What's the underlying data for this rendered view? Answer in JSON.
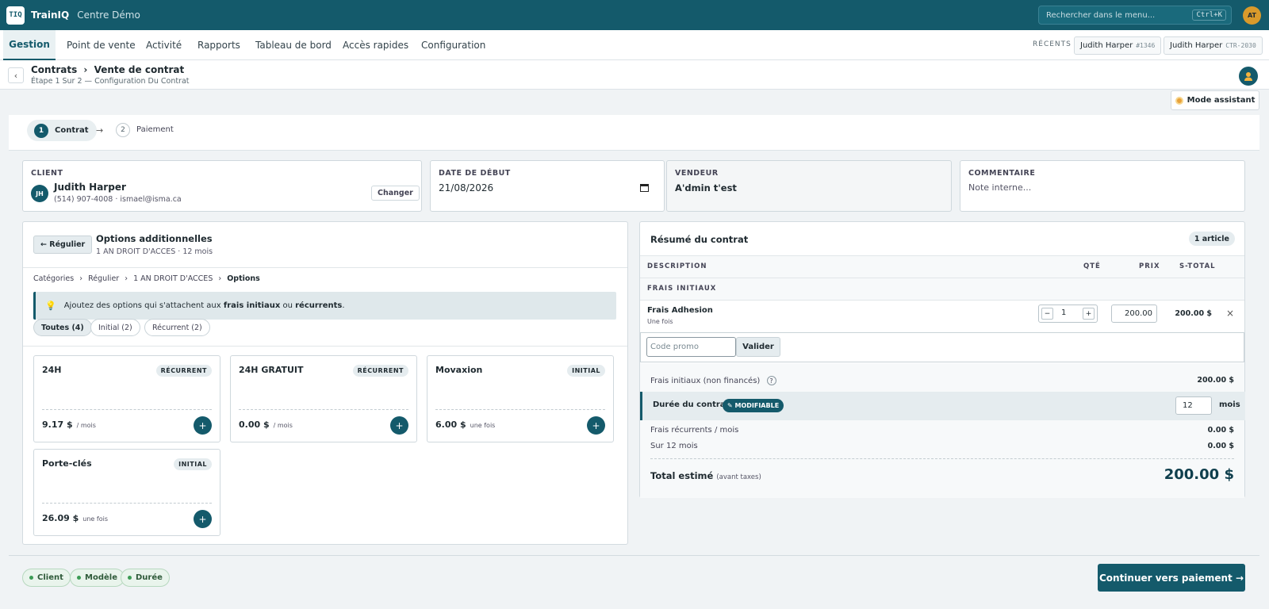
{
  "app": {
    "logo": "TIQ",
    "name": "TrainIQ",
    "centre": "Centre Démo",
    "search_placeholder": "Rechercher dans le menu...",
    "search_shortcut": "Ctrl+K",
    "user_initials": "AT"
  },
  "nav": {
    "tabs": [
      "Gestion",
      "Point de vente",
      "Activité",
      "Rapports",
      "Tableau de bord",
      "Accès rapides",
      "Configuration"
    ],
    "recent_label": "RÉCENTS",
    "recent": [
      {
        "name": "Judith Harper",
        "code": "#1346"
      },
      {
        "name": "Judith Harper",
        "code": "CTR-2030"
      }
    ]
  },
  "breadcrumb": {
    "parent": "Contrats",
    "sep": "›",
    "current": "Vente de contrat",
    "subtitle": "Étape 1 Sur 2 — Configuration Du Contrat",
    "back": "‹"
  },
  "assistant": {
    "label": "Mode assistant"
  },
  "steps": [
    {
      "num": "1",
      "label": "Contrat"
    },
    {
      "num": "2",
      "label": "Paiement"
    }
  ],
  "step_arrow": "→",
  "fields": {
    "client": {
      "label": "CLIENT",
      "initials": "JH",
      "name": "Judith Harper",
      "contact": "(514) 907-4008 · ismael@isma.ca",
      "change": "Changer"
    },
    "date": {
      "label": "DATE DE DÉBUT",
      "value": "21/08/2026"
    },
    "vendeur": {
      "label": "VENDEUR",
      "value": "A'dmin t'est"
    },
    "commentaire": {
      "label": "COMMENTAIRE",
      "placeholder": "Note interne..."
    }
  },
  "options": {
    "back": "← Régulier",
    "title": "Options additionnelles",
    "subtitle": "1 AN DROIT D'ACCES · 12 mois",
    "crumbs": [
      "Catégories",
      "Régulier",
      "1 AN DROIT D'ACCES",
      "Options"
    ],
    "tip_pre": "Ajoutez des options qui s'attachent aux ",
    "tip_b1": "frais initiaux",
    "tip_mid": " ou ",
    "tip_b2": "récurrents",
    "tip_post": ".",
    "filters": [
      "Toutes (4)",
      "Initial (2)",
      "Récurrent (2)"
    ],
    "cards": [
      {
        "title": "24H",
        "badge": "RÉCURRENT",
        "price": "9.17 $",
        "unit": "/ mois"
      },
      {
        "title": "24H GRATUIT",
        "badge": "RÉCURRENT",
        "price": "0.00 $",
        "unit": "/ mois"
      },
      {
        "title": "Movaxion",
        "badge": "INITIAL",
        "price": "6.00 $",
        "unit": "une fois"
      },
      {
        "title": "Porte-clés",
        "badge": "INITIAL",
        "price": "26.09 $",
        "unit": "une fois"
      }
    ],
    "add": "+"
  },
  "summary": {
    "title": "Résumé du contrat",
    "count": "1 article",
    "headers": {
      "desc": "DESCRIPTION",
      "qty": "QTÉ",
      "price": "PRIX",
      "subtotal": "S-TOTAL"
    },
    "section": "FRAIS INITIAUX",
    "item": {
      "name": "Frais Adhesion",
      "freq": "Une fois",
      "qty": "1",
      "price": "200.00",
      "subtotal": "200.00 $",
      "minus": "−",
      "plus": "+",
      "remove": "×"
    },
    "promo_placeholder": "Code promo",
    "validate": "Valider",
    "initial_label": "Frais initiaux (non financés)",
    "initial_value": "200.00 $",
    "info": "?",
    "duration_label": "Durée du contrat",
    "duration_badge": "✎ MODIFIABLE",
    "duration_value": "12",
    "duration_unit": "mois",
    "recurring_label": "Frais récurrents / mois",
    "recurring_value": "0.00 $",
    "over_label": "Sur 12 mois",
    "over_value": "0.00 $",
    "total_label": "Total estimé",
    "total_note": "(avant taxes)",
    "total_value": "200.00 $"
  },
  "footer": {
    "checks": [
      "Client",
      "Modèle",
      "Durée"
    ],
    "continue": "Continuer vers paiement →"
  }
}
